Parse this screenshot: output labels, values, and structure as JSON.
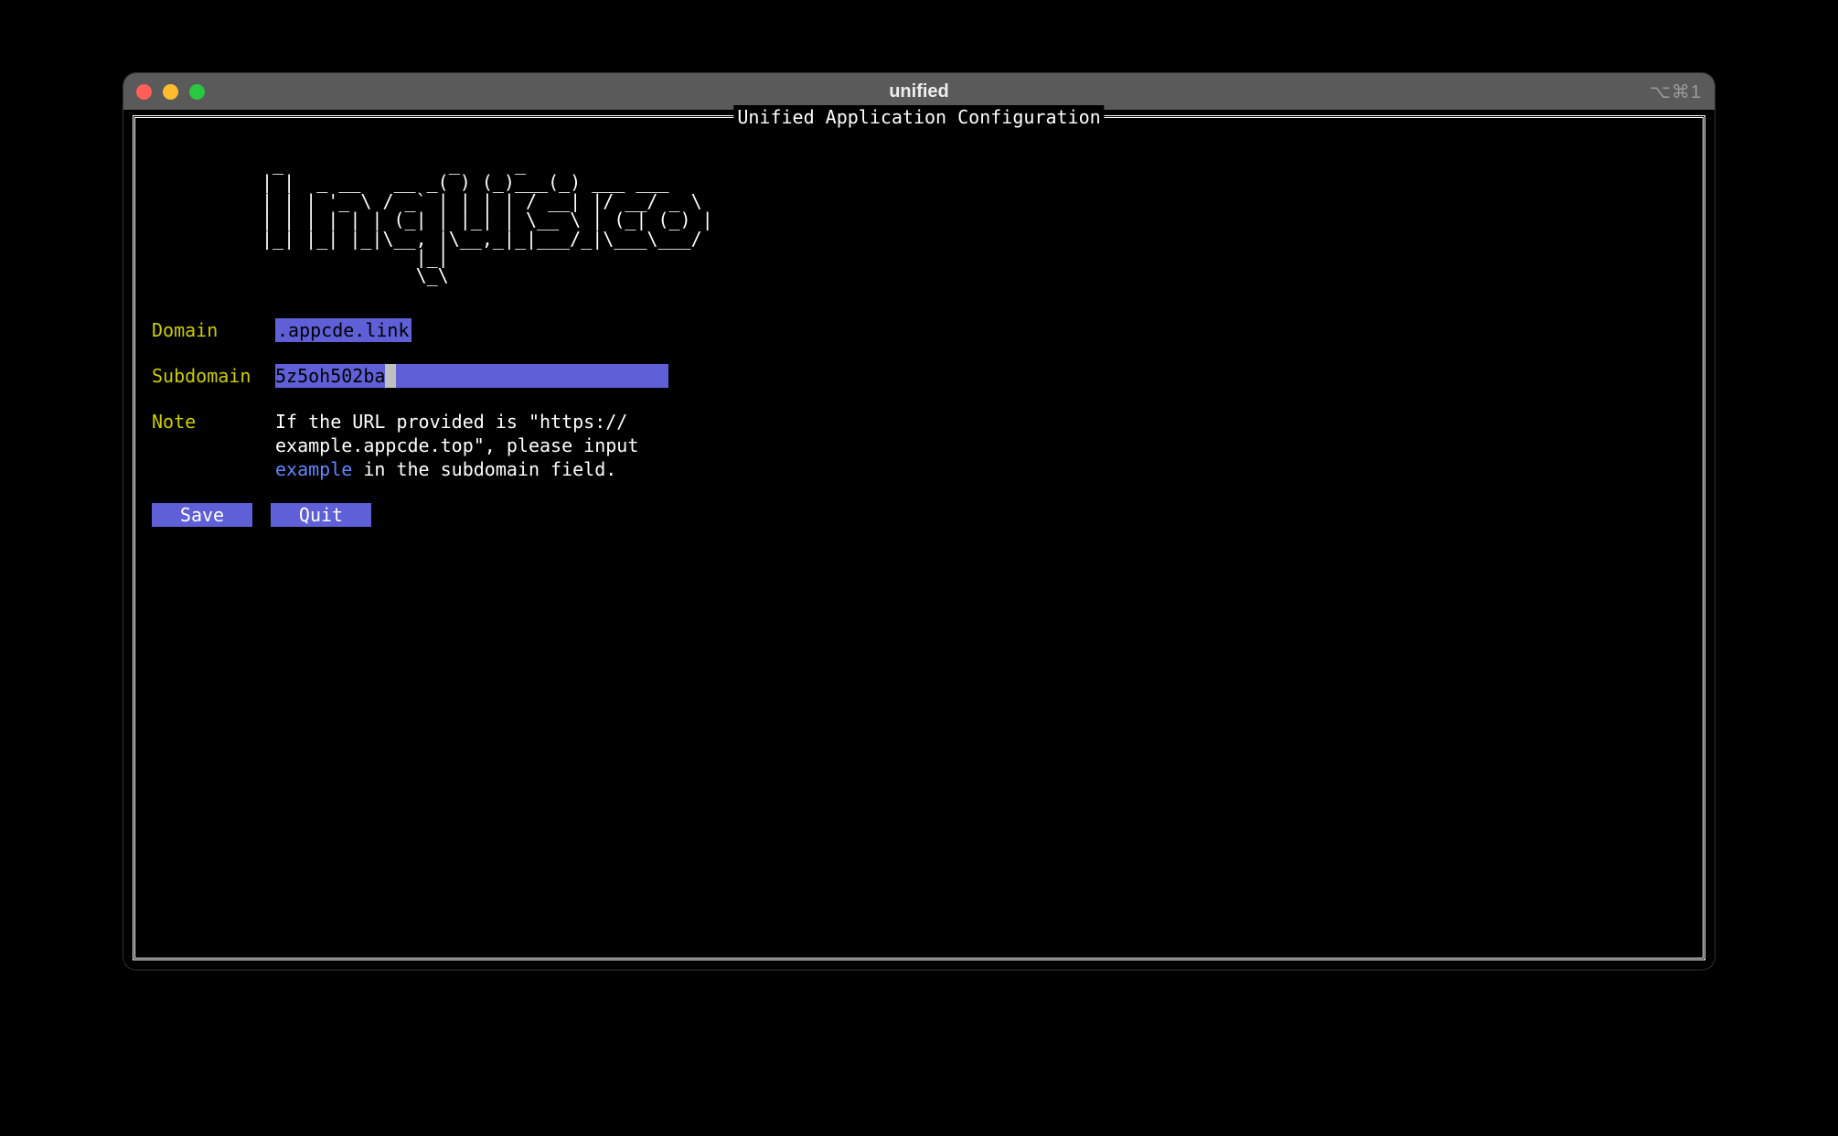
{
  "window": {
    "title": "unified",
    "shortcut": "⌥⌘1"
  },
  "frame": {
    "title": "Unified Application Configuration"
  },
  "ascii": " _               _     _           \n| |  _ __   __ _( ) (_)___(_) ___ ___  \n| | | '_ \\ / _` | | | | / __| |/ __/ _ \\ \n| | | | | | (_| | |_| | \\__ \\ | (_| (_) |\n|_| |_| |_|\\__, |\\__,_|_|___/_|\\___\\___/ \n              |_|                        \n              \\_\\                        ",
  "fields": {
    "domain": {
      "label": "Domain",
      "value": ".appcde.link"
    },
    "subdomain": {
      "label": "Subdomain",
      "value": "5z5oh502ba"
    },
    "note": {
      "label": "Note",
      "line1": "If the URL provided is \"https://",
      "line2": "example.appcde.top\", please input",
      "line3a": "example",
      "line3b": " in the subdomain field."
    }
  },
  "buttons": {
    "save": "Save",
    "quit": "Quit"
  }
}
